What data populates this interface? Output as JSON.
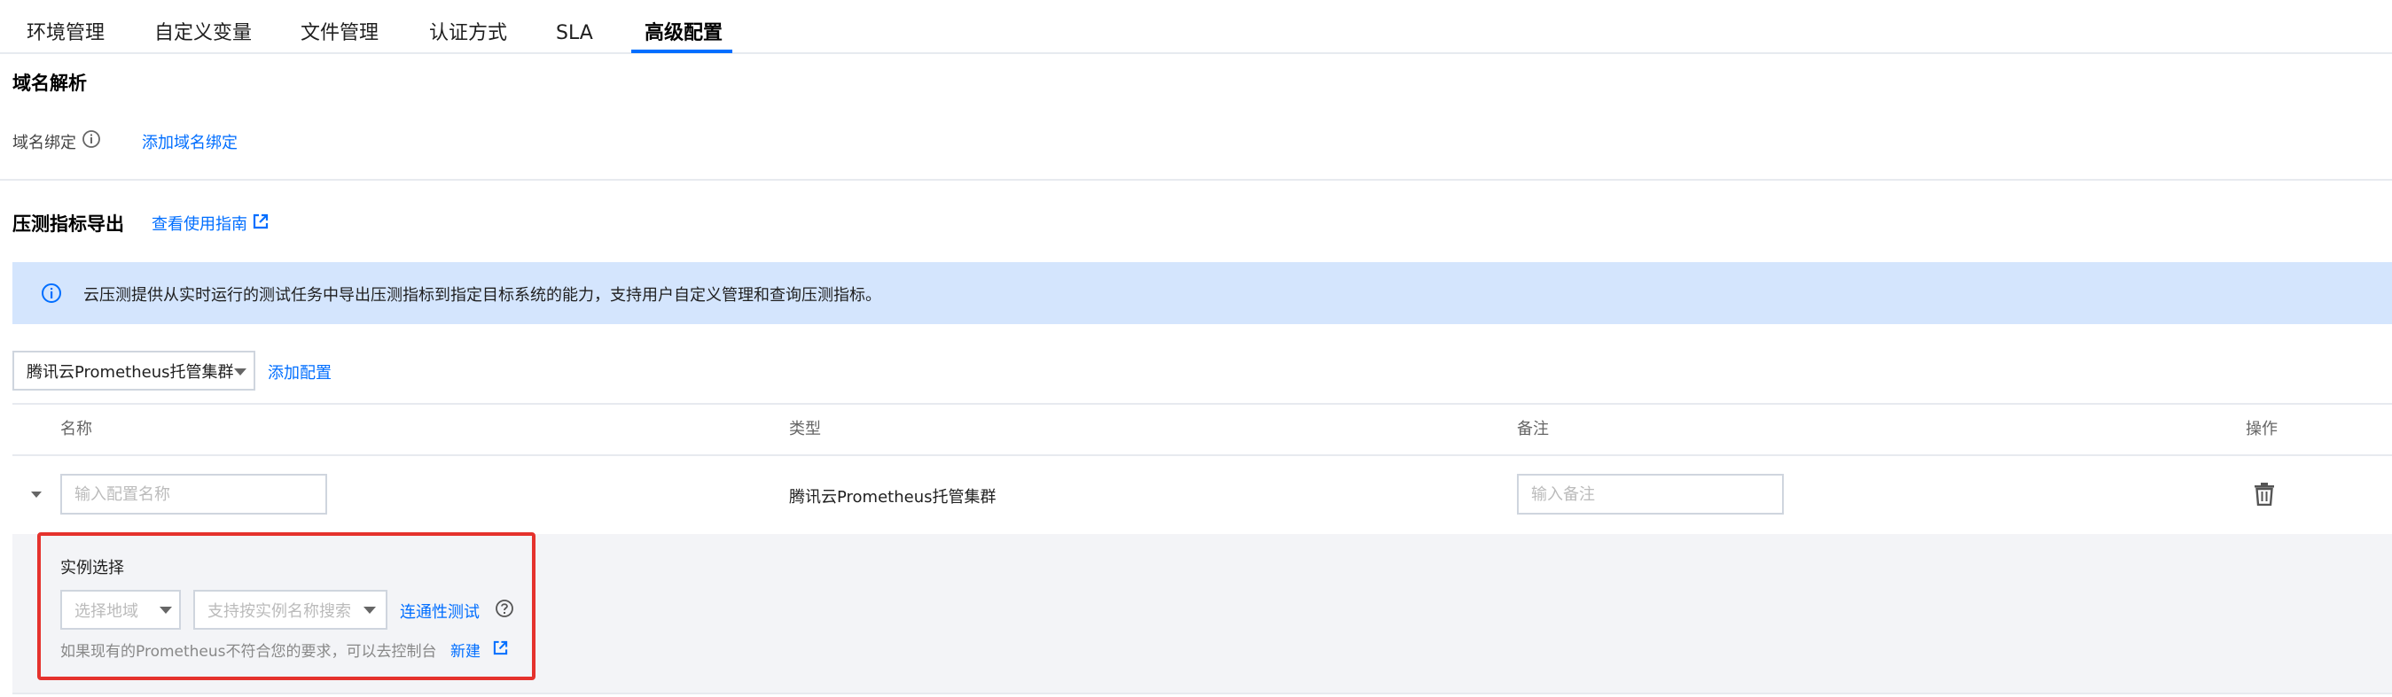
{
  "tabs": [
    {
      "label": "环境管理"
    },
    {
      "label": "自定义变量"
    },
    {
      "label": "文件管理"
    },
    {
      "label": "认证方式"
    },
    {
      "label": "SLA"
    },
    {
      "label": "高级配置",
      "active": true
    }
  ],
  "domain_section": {
    "title": "域名解析",
    "binding_label": "域名绑定",
    "add_link": "添加域名绑定"
  },
  "metrics_section": {
    "title": "压测指标导出",
    "guide_link": "查看使用指南",
    "notice": "云压测提供从实时运行的测试任务中导出压测指标到指定目标系统的能力，支持用户自定义管理和查询压测指标。",
    "type_select_value": "腾讯云Prometheus托管集群",
    "add_config_link": "添加配置"
  },
  "table": {
    "headers": [
      "名称",
      "类型",
      "备注",
      "操作"
    ],
    "row": {
      "name_placeholder": "输入配置名称",
      "type": "腾讯云Prometheus托管集群",
      "remark_placeholder": "输入备注"
    }
  },
  "instance_panel": {
    "title": "实例选择",
    "region_placeholder": "选择地域",
    "search_placeholder": "支持按实例名称搜索",
    "test_link": "连通性测试",
    "hint_text": "如果现有的Prometheus不符合您的要求，可以去控制台",
    "new_link": "新建"
  },
  "colors": {
    "accent": "#006eff",
    "notice_bg": "#d4e5fd",
    "highlight": "#e5322d",
    "panel_bg": "#f3f4f7"
  }
}
